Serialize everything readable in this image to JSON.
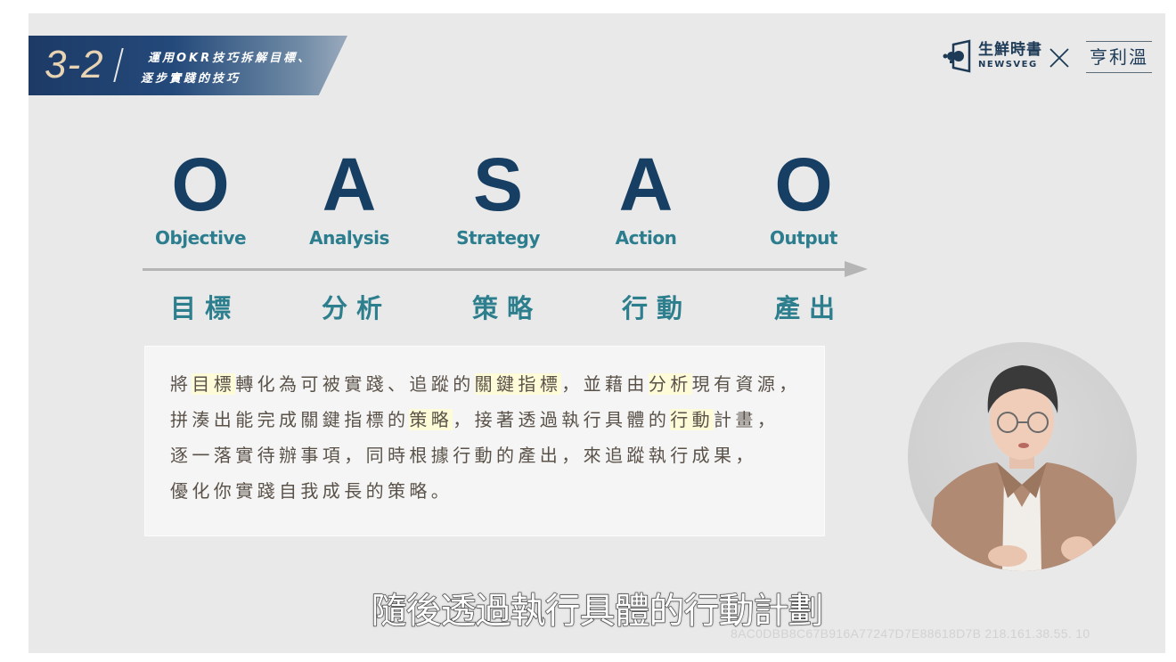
{
  "banner": {
    "number": "3-2",
    "line1": "運用OKR技巧拆解目標、",
    "line2": "逐步實踐的技巧"
  },
  "logo": {
    "name_cn": "生鮮時書",
    "name_en": "NEWSVEG",
    "icon": "megaphone-book-icon",
    "separator_icon": "times-icon",
    "partner": "亨利溫"
  },
  "framework": {
    "steps": [
      {
        "letter": "O",
        "en": "Objective",
        "cn": "目標"
      },
      {
        "letter": "A",
        "en": "Analysis",
        "cn": "分析"
      },
      {
        "letter": "S",
        "en": "Strategy",
        "cn": "策略"
      },
      {
        "letter": "A",
        "en": "Action",
        "cn": "行動"
      },
      {
        "letter": "O",
        "en": "Output",
        "cn": "產出"
      }
    ],
    "arrow_icon": "right-arrow-icon"
  },
  "description": {
    "lines": [
      [
        {
          "t": "將"
        },
        {
          "t": "目標",
          "hl": true
        },
        {
          "t": "轉化為可被實踐、追蹤的"
        },
        {
          "t": "關鍵指標",
          "hl": true
        },
        {
          "t": "，並藉由"
        },
        {
          "t": "分析",
          "hl": true
        },
        {
          "t": "現有資源，"
        }
      ],
      [
        {
          "t": "拼湊出能完成關鍵指標的"
        },
        {
          "t": "策略",
          "hl": true
        },
        {
          "t": "，接著透過執行具體的"
        },
        {
          "t": "行動",
          "hl": true
        },
        {
          "t": "計畫，"
        }
      ],
      [
        {
          "t": "逐一落實待辦事項，同時根據行動的產出，來追蹤執行成果，"
        }
      ],
      [
        {
          "t": "優化你實踐自我成長的策略。"
        }
      ]
    ],
    "highlight_color": "#fdfbd8"
  },
  "presenter": {
    "label": "presenter-video"
  },
  "subtitle": "隨後透過執行具體的行動計劃",
  "watermark": "8AC0DBB8C67B916A77247D7E88618D7B  218.161.38.55. 10"
}
